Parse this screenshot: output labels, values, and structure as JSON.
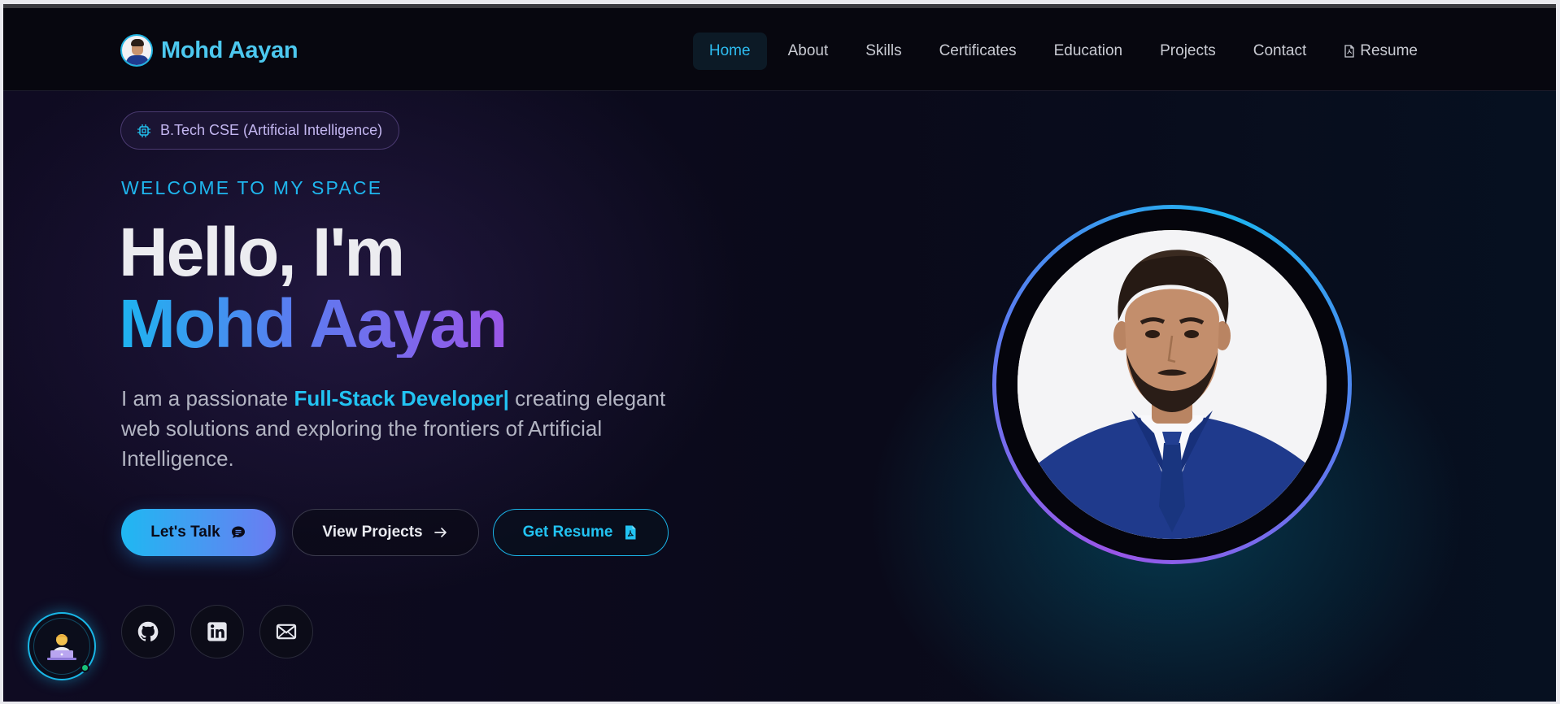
{
  "brand": {
    "name": "Mohd Aayan"
  },
  "nav": {
    "items": [
      {
        "label": "Home",
        "active": true
      },
      {
        "label": "About",
        "active": false
      },
      {
        "label": "Skills",
        "active": false
      },
      {
        "label": "Certificates",
        "active": false
      },
      {
        "label": "Education",
        "active": false
      },
      {
        "label": "Projects",
        "active": false
      },
      {
        "label": "Contact",
        "active": false
      },
      {
        "label": "Resume",
        "active": false,
        "icon": "pdf-file-icon"
      }
    ]
  },
  "hero": {
    "badge": {
      "label": "B.Tech CSE (Artificial Intelligence)",
      "icon": "cpu-chip-icon"
    },
    "welcome": "WELCOME TO MY SPACE",
    "greeting": "Hello, I'm",
    "name": "Mohd Aayan",
    "intro_pre": "I am a passionate ",
    "intro_highlight": "Full-Stack Developer",
    "intro_cursor": "|",
    "intro_post": " creating elegant web solutions and exploring the frontiers of Artificial Intelligence.",
    "buttons": {
      "talk": {
        "label": "Let's Talk",
        "icon": "chat-bubble-icon"
      },
      "projects": {
        "label": "View Projects",
        "icon": "arrow-right-icon"
      },
      "resume": {
        "label": "Get Resume",
        "icon": "pdf-file-icon"
      }
    },
    "socials": [
      {
        "name": "github-icon"
      },
      {
        "name": "linkedin-icon"
      },
      {
        "name": "mail-icon"
      }
    ]
  },
  "floating_assistant": {
    "icon": "developer-emoji-icon",
    "status": "online"
  },
  "colors": {
    "accent_cyan": "#1fb6ee",
    "accent_purple": "#9a56e8",
    "background": "#090812"
  }
}
